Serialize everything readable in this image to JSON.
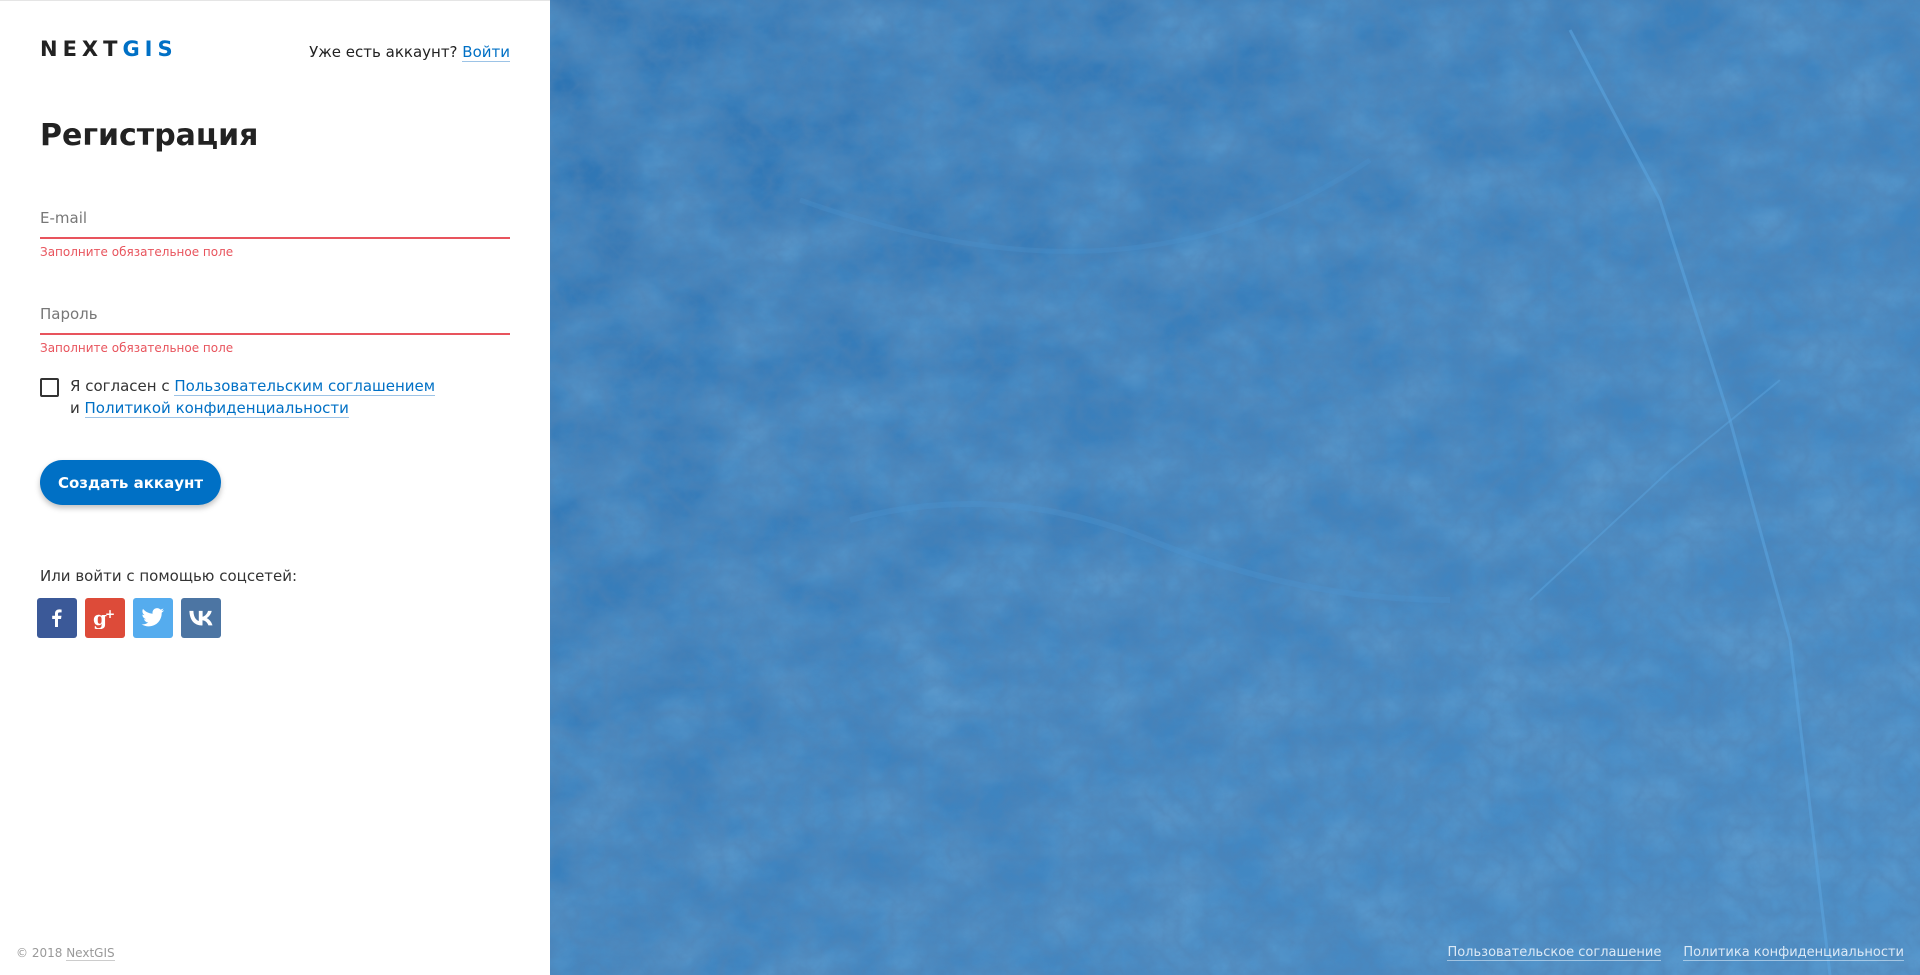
{
  "brand": {
    "logo_part1": "NEXT",
    "logo_part2": "GIS",
    "accent": "#0070c5"
  },
  "header": {
    "have_account": "Уже есть аккаунт?",
    "login_link": "Войти"
  },
  "form": {
    "title": "Регистрация",
    "email": {
      "placeholder": "E-mail",
      "value": "",
      "error": "Заполните обязательное поле"
    },
    "password": {
      "placeholder": "Пароль",
      "value": "",
      "error": "Заполните обязательное поле"
    },
    "agreement": {
      "checked": false,
      "prefix": "Я согласен с",
      "terms_link": "Пользовательским соглашением",
      "and": "и",
      "privacy_link": "Политикой конфиденциальности"
    },
    "submit_label": "Создать аккаунт"
  },
  "social": {
    "label": "Или войти с помощью соцсетей:",
    "items": [
      {
        "icon": "facebook-icon",
        "glyph": "f",
        "color": "#3b5998"
      },
      {
        "icon": "google-plus-icon",
        "glyph": "g+",
        "color": "#dd4b39"
      },
      {
        "icon": "twitter-icon",
        "glyph": "twitter-bird",
        "color": "#55acee"
      },
      {
        "icon": "vk-icon",
        "glyph": "vk",
        "color": "#4c75a3"
      }
    ]
  },
  "footer": {
    "copyright_prefix": "© 2018",
    "copyright_link": "NextGIS",
    "terms": "Пользовательское соглашение",
    "privacy": "Политика конфиденциальности"
  },
  "colors": {
    "error": "#e8545d",
    "map_overlay": "#2f77b6"
  }
}
